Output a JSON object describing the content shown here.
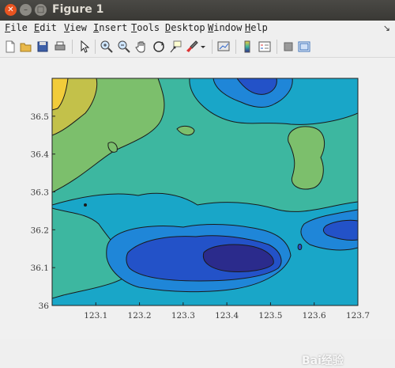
{
  "window": {
    "title": "Figure 1"
  },
  "menu": [
    "File",
    "Edit",
    "View",
    "Insert",
    "Tools",
    "Desktop",
    "Window",
    "Help"
  ],
  "toolbar_icons": [
    "new-figure-icon",
    "open-icon",
    "save-icon",
    "print-icon",
    "pointer-icon",
    "zoom-in-icon",
    "zoom-out-icon",
    "pan-icon",
    "rotate-3d-icon",
    "data-cursor-icon",
    "brush-icon",
    "brush-dropdown-icon",
    "link-plot-icon",
    "colorbar-icon",
    "legend-icon",
    "hide-plot-tools-icon",
    "show-plot-tools-icon"
  ],
  "chart_data": {
    "type": "contour",
    "title": "",
    "xlabel": "",
    "ylabel": "",
    "xlim": [
      123.0,
      123.7
    ],
    "ylim": [
      36.0,
      36.6
    ],
    "xticks": [
      "123.1",
      "123.2",
      "123.3",
      "123.4",
      "123.5",
      "123.6",
      "123.7"
    ],
    "yticks": [
      "36",
      "36.1",
      "36.2",
      "36.3",
      "36.4",
      "36.5"
    ],
    "colormap": [
      "#2b2b8c",
      "#2352c8",
      "#1f86d8",
      "#19a6c8",
      "#3db7a0",
      "#7cbf6c",
      "#c3c14a",
      "#f2cc3a"
    ],
    "grid": false
  },
  "watermark": "Bai经验"
}
